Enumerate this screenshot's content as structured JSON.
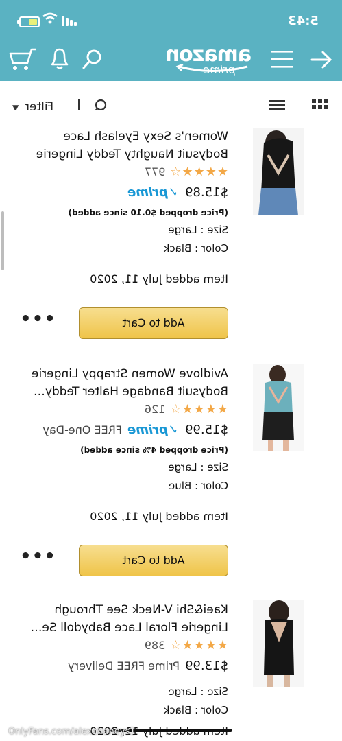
{
  "status_bar": {
    "time": "5:43"
  },
  "nav": {
    "logo_text": "amazon",
    "logo_sub": "prime"
  },
  "filter_bar": {
    "filter_label": "Filter"
  },
  "items": [
    {
      "title": "Women's Sexy Eyelash Lace Bodysuit Naughty Teddy Lingerie",
      "stars": "★★★★☆",
      "rating_count": "977",
      "price": "$15.89",
      "prime": "✓prime",
      "delivery": "",
      "price_drop": "(Price dropped $0.10 since added)",
      "size": "Size : Large",
      "color": "Color : Black",
      "added": "Item added July 11, 2020",
      "cart_label": "Add to Cart",
      "image_palette": "#1c1c1c"
    },
    {
      "title": "Avidlove Women Strappy Lingerie Bodysuit Bandage Halter Teddy…",
      "stars": "★★★★☆",
      "rating_count": "126",
      "price": "$15.99",
      "prime": "✓prime",
      "delivery": "FREE One-Day",
      "price_drop": "(Price dropped 4% since added)",
      "size": "Size : Large",
      "color": "Color : Blue",
      "added": "Item added July 11, 2020",
      "cart_label": "Add to Cart",
      "image_palette": "#5fa7b0"
    },
    {
      "title": "Kaei&Shi V-Neck See Through Lingerie Floral Lace Babydoll Se…",
      "stars": "★★★★☆",
      "rating_count": "389",
      "price": "$13.99",
      "prime": "",
      "delivery": "Prime FREE Delivery",
      "size": "Size : Large",
      "color": "Color : Black",
      "added": "Item added July 11, 2020"
    }
  ],
  "watermark": "OnlyFans.com/alexahaneys1",
  "colors": {
    "header": "#5ab2c2",
    "accent": "#e5872c",
    "prime": "#1a98d5",
    "stars": "#f3a847",
    "cart_button": "#f0c14b"
  }
}
